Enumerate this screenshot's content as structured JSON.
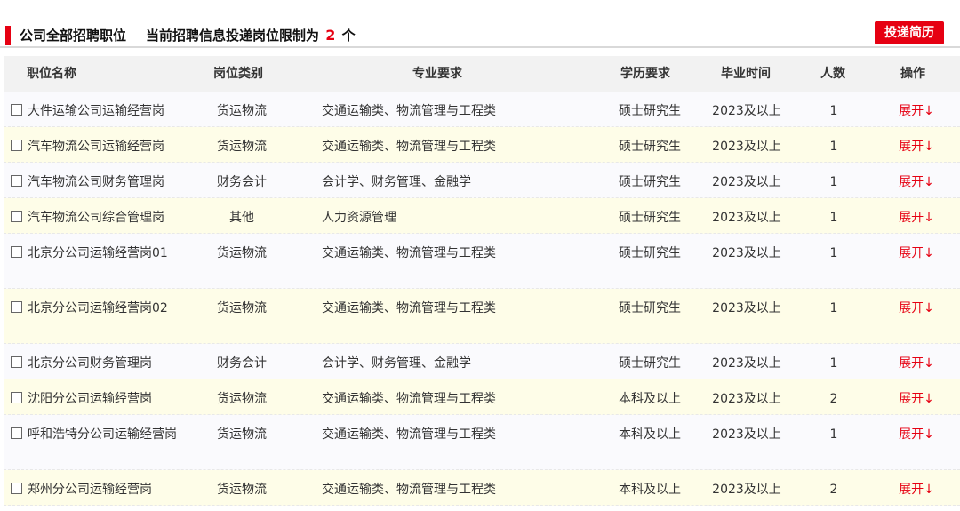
{
  "header": {
    "title_prefix": "公司全部招聘职位",
    "title_middle": "当前招聘信息投递岗位限制为",
    "limit": "2",
    "title_suffix": "个",
    "apply_label": "投递简历"
  },
  "colors": {
    "accent": "#e60012",
    "row_odd": "#fafafd",
    "row_even": "#fefde8",
    "header_bg": "#f2f2f2"
  },
  "table": {
    "columns": [
      "职位名称",
      "岗位类别",
      "专业要求",
      "学历要求",
      "毕业时间",
      "人数",
      "操作"
    ],
    "expand_label": "展开↓",
    "rows": [
      {
        "name": "大件运输公司运输经营岗",
        "category": "货运物流",
        "major": "交通运输类、物流管理与工程类",
        "degree": "硕士研究生",
        "grad": "2023及以上",
        "count": "1"
      },
      {
        "name": "汽车物流公司运输经营岗",
        "category": "货运物流",
        "major": "交通运输类、物流管理与工程类",
        "degree": "硕士研究生",
        "grad": "2023及以上",
        "count": "1"
      },
      {
        "name": "汽车物流公司财务管理岗",
        "category": "财务会计",
        "major": "会计学、财务管理、金融学",
        "degree": "硕士研究生",
        "grad": "2023及以上",
        "count": "1"
      },
      {
        "name": "汽车物流公司综合管理岗",
        "category": "其他",
        "major": "人力资源管理",
        "degree": "硕士研究生",
        "grad": "2023及以上",
        "count": "1"
      },
      {
        "name": "北京分公司运输经营岗01",
        "category": "货运物流",
        "major": "交通运输类、物流管理与工程类",
        "degree": "硕士研究生",
        "grad": "2023及以上",
        "count": "1"
      },
      {
        "name": "北京分公司运输经营岗02",
        "category": "货运物流",
        "major": "交通运输类、物流管理与工程类",
        "degree": "硕士研究生",
        "grad": "2023及以上",
        "count": "1"
      },
      {
        "name": "北京分公司财务管理岗",
        "category": "财务会计",
        "major": "会计学、财务管理、金融学",
        "degree": "硕士研究生",
        "grad": "2023及以上",
        "count": "1"
      },
      {
        "name": "沈阳分公司运输经营岗",
        "category": "货运物流",
        "major": "交通运输类、物流管理与工程类",
        "degree": "本科及以上",
        "grad": "2023及以上",
        "count": "2"
      },
      {
        "name": "呼和浩特分公司运输经营岗",
        "category": "货运物流",
        "major": "交通运输类、物流管理与工程类",
        "degree": "本科及以上",
        "grad": "2023及以上",
        "count": "1"
      },
      {
        "name": "郑州分公司运输经营岗",
        "category": "货运物流",
        "major": "交通运输类、物流管理与工程类",
        "degree": "本科及以上",
        "grad": "2023及以上",
        "count": "2"
      }
    ]
  }
}
